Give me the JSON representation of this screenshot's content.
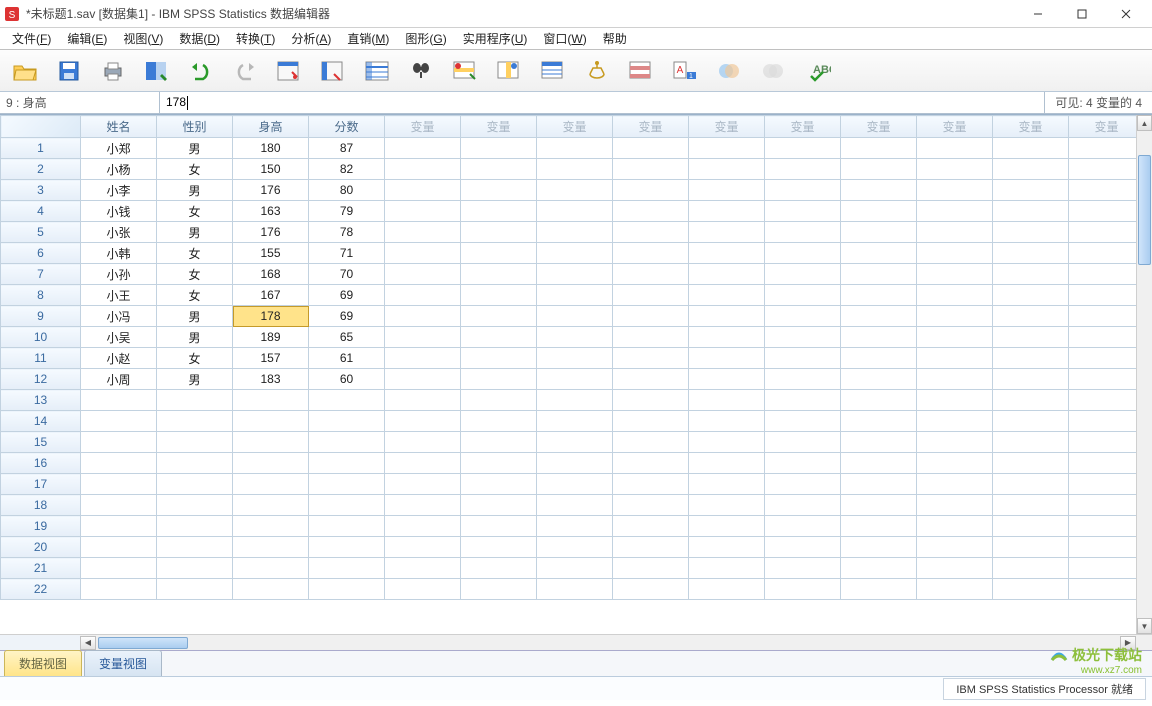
{
  "window": {
    "title": "*未标题1.sav [数据集1] - IBM SPSS Statistics 数据编辑器"
  },
  "menu": {
    "items": [
      {
        "label": "文件",
        "accel": "F"
      },
      {
        "label": "编辑",
        "accel": "E"
      },
      {
        "label": "视图",
        "accel": "V"
      },
      {
        "label": "数据",
        "accel": "D"
      },
      {
        "label": "转换",
        "accel": "T"
      },
      {
        "label": "分析",
        "accel": "A"
      },
      {
        "label": "直销",
        "accel": "M"
      },
      {
        "label": "图形",
        "accel": "G"
      },
      {
        "label": "实用程序",
        "accel": "U"
      },
      {
        "label": "窗口",
        "accel": "W"
      },
      {
        "label": "帮助",
        "accel": ""
      }
    ]
  },
  "cellbar": {
    "ref": "9 : 身高",
    "value": "178",
    "visible_info": "可见: 4 变量的 4"
  },
  "grid": {
    "data_cols": [
      "姓名",
      "性别",
      "身高",
      "分数"
    ],
    "extra_col_label": "变量",
    "extra_col_count": 10,
    "rows": [
      {
        "n": "1",
        "vals": [
          "小郑",
          "男",
          "180",
          "87"
        ]
      },
      {
        "n": "2",
        "vals": [
          "小杨",
          "女",
          "150",
          "82"
        ]
      },
      {
        "n": "3",
        "vals": [
          "小李",
          "男",
          "176",
          "80"
        ]
      },
      {
        "n": "4",
        "vals": [
          "小钱",
          "女",
          "163",
          "79"
        ]
      },
      {
        "n": "5",
        "vals": [
          "小张",
          "男",
          "176",
          "78"
        ]
      },
      {
        "n": "6",
        "vals": [
          "小韩",
          "女",
          "155",
          "71"
        ]
      },
      {
        "n": "7",
        "vals": [
          "小孙",
          "女",
          "168",
          "70"
        ]
      },
      {
        "n": "8",
        "vals": [
          "小王",
          "女",
          "167",
          "69"
        ]
      },
      {
        "n": "9",
        "vals": [
          "小冯",
          "男",
          "178",
          "69"
        ]
      },
      {
        "n": "10",
        "vals": [
          "小吴",
          "男",
          "189",
          "65"
        ]
      },
      {
        "n": "11",
        "vals": [
          "小赵",
          "女",
          "157",
          "61"
        ]
      },
      {
        "n": "12",
        "vals": [
          "小周",
          "男",
          "183",
          "60"
        ]
      }
    ],
    "empty_rows": [
      13,
      14,
      15,
      16,
      17,
      18,
      19,
      20,
      21,
      22
    ],
    "active": {
      "row": 9,
      "col": 2
    }
  },
  "view_tabs": {
    "data": "数据视图",
    "variable": "变量视图"
  },
  "status": {
    "processor": "IBM SPSS Statistics Processor 就绪"
  },
  "watermark": {
    "name": "极光下载站",
    "url": "www.xz7.com"
  }
}
